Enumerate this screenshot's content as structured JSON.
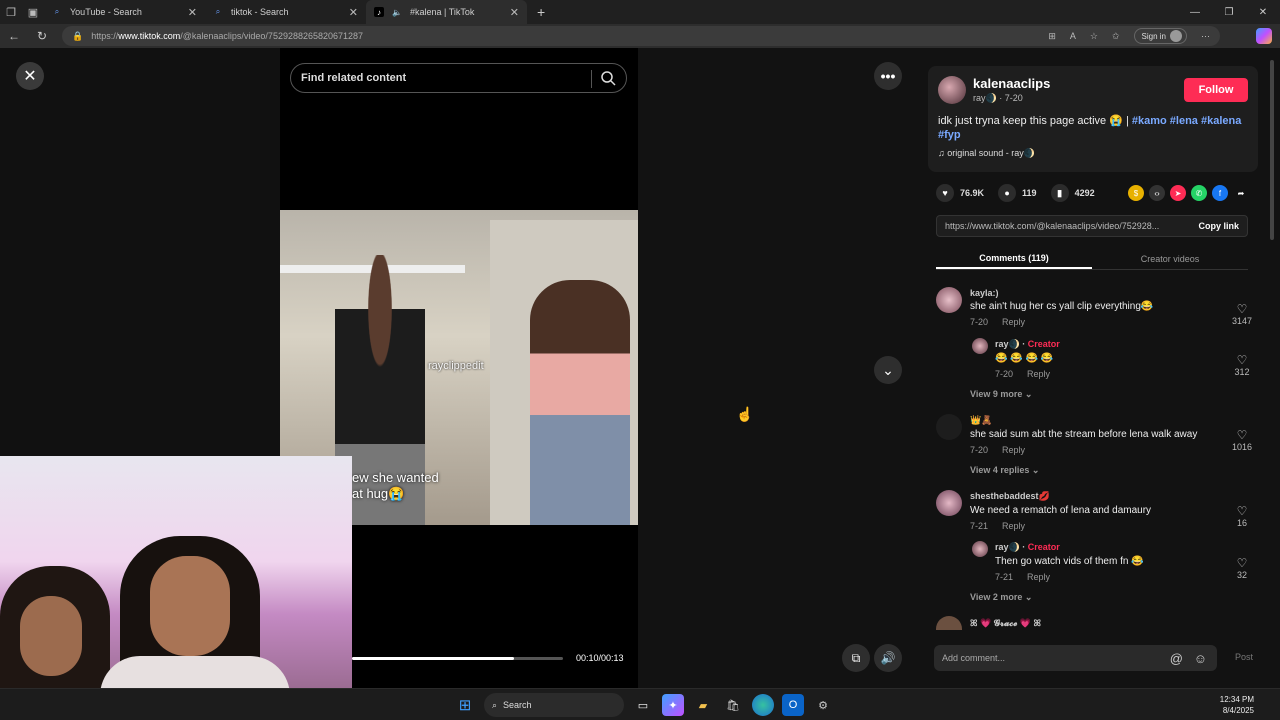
{
  "browser": {
    "tabs": [
      {
        "title": "YouTube - Search",
        "active": false
      },
      {
        "title": "tiktok - Search",
        "active": false
      },
      {
        "title": "#kalena | TikTok",
        "active": true
      }
    ],
    "url_prefix": "https://",
    "url_host": "www.tiktok.com",
    "url_path": "/@kalenaaclips/video/7529288265820671287",
    "signin_label": "Sign in"
  },
  "player": {
    "search_placeholder": "Find related content",
    "watermark": "rayclippedit",
    "caption_line1": "ew she wanted",
    "caption_line2": "at hug😭",
    "time": "00:10/00:13",
    "progress": 0.77
  },
  "post": {
    "username": "kalenaaclips",
    "subline": "ray🌒 · 7-20",
    "follow_label": "Follow",
    "desc_text": "idk just tryna keep this page active 😭 | ",
    "hashtags": [
      "#kamo",
      "#lena",
      "#kalena",
      "#fyp"
    ],
    "sound": "original sound - ray🌒",
    "likes": "76.9K",
    "comments": "119",
    "saves": "4292",
    "link": "https://www.tiktok.com/@kalenaaclips/video/752928...",
    "copy_label": "Copy link"
  },
  "tabs": {
    "comments": "Comments (119)",
    "creator": "Creator videos"
  },
  "comments": [
    {
      "name": "kayla:)",
      "text": "she ain't hug her cs yall clip everything😂",
      "date": "7-20",
      "reply": "Reply",
      "likes": "3147"
    },
    {
      "name": "ray🌒 · ",
      "creator": "Creator",
      "text": "😂 😂 😂 😂",
      "date": "7-20",
      "reply": "Reply",
      "likes": "312"
    },
    {
      "name": "👑🧸",
      "text": "she said sum abt the stream before lena walk away",
      "date": "7-20",
      "reply": "Reply",
      "likes": "1016"
    },
    {
      "name": "shesthebaddest💋",
      "text": "We need a rematch of lena and damaury",
      "date": "7-21",
      "reply": "Reply",
      "likes": "16"
    },
    {
      "name": "ray🌒 · ",
      "creator": "Creator",
      "text": "Then go watch vids of them fn 😂",
      "date": "7-21",
      "reply": "Reply",
      "likes": "32"
    },
    {
      "name": "ꕤ 💗 𝓖𝓻𝓪𝓬𝓮 💗 ꕤ"
    }
  ],
  "view_more": [
    "View 9 more",
    "View 4 replies",
    "View 2 more"
  ],
  "composer": {
    "placeholder": "Add comment...",
    "post_label": "Post"
  },
  "taskbar": {
    "search_label": "Search",
    "time": "12:34 PM",
    "date": "8/4/2025"
  },
  "colors": {
    "accent": "#fe2c55",
    "hashtag": "#7aa9ff"
  }
}
